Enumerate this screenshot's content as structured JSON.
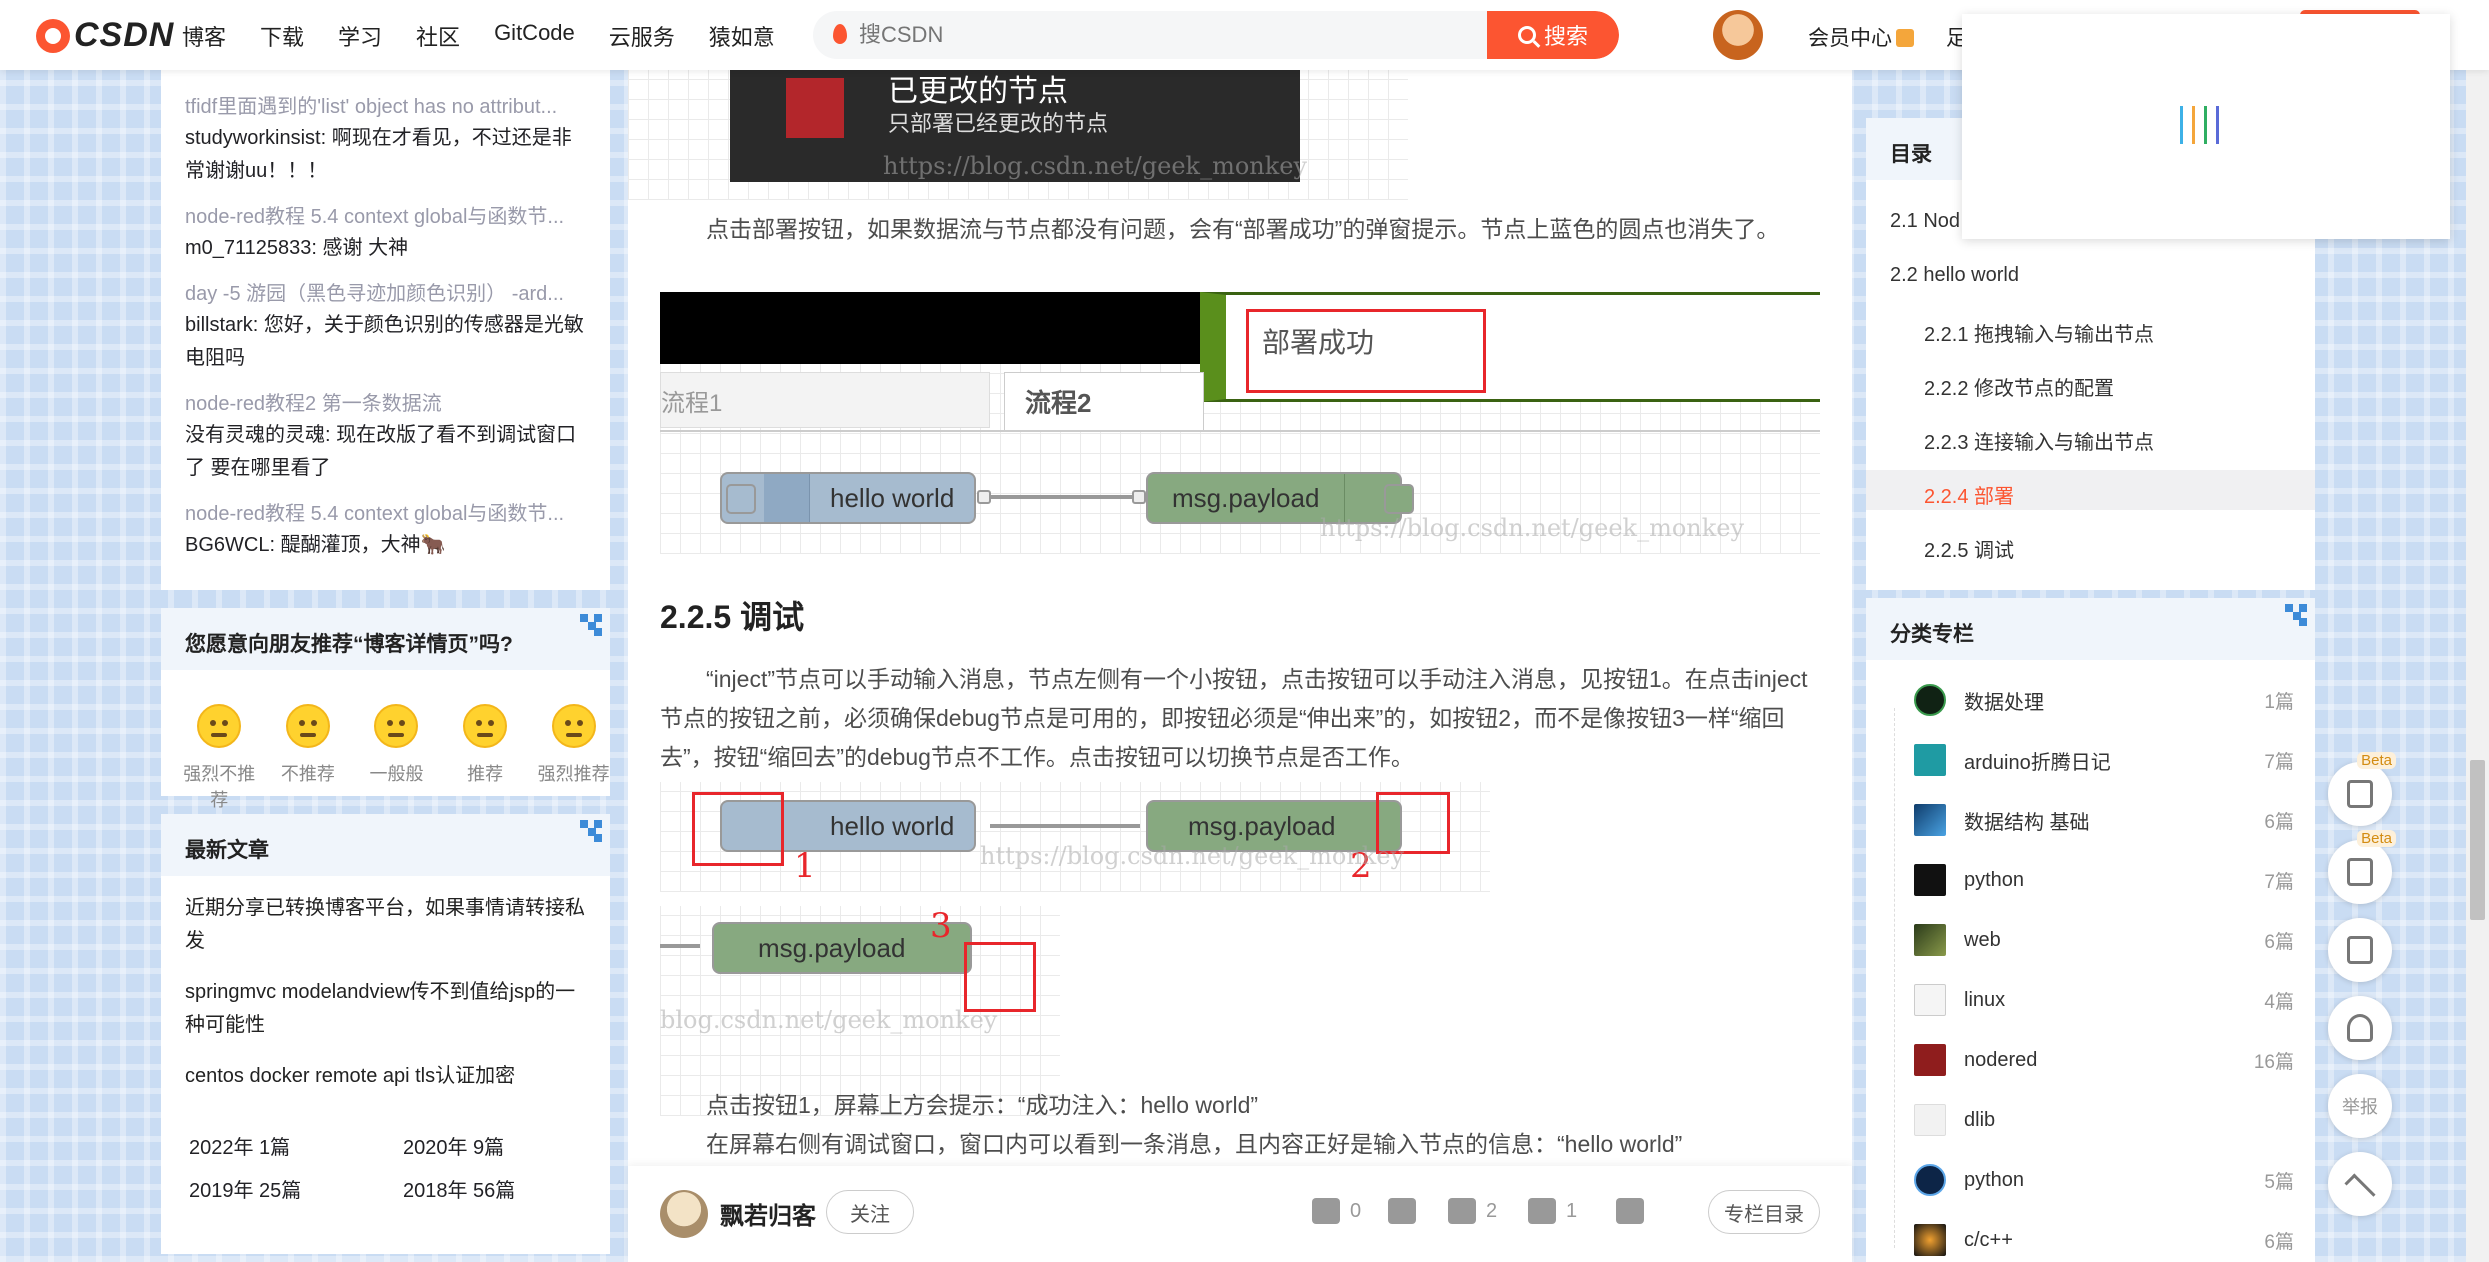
{
  "header": {
    "logo_text": "CSDN",
    "nav": [
      "博客",
      "下载",
      "学习",
      "社区",
      "GitCode",
      "云服务",
      "猿如意"
    ],
    "search_placeholder": "搜CSDN",
    "search_button": "搜索",
    "vip_label": "会员中心",
    "more_label": "足"
  },
  "loader_colors": [
    "#3db1e7",
    "#f4a63b",
    "#2fae62",
    "#5a6bd8"
  ],
  "left": {
    "comments": [
      {
        "title": "tfidf里面遇到的'list' object has no attribut...",
        "body": "studyworkinsist: 啊现在才看见，不过还是非常谢谢uu！！！"
      },
      {
        "title": "node-red教程 5.4 context global与函数节...",
        "body": "m0_71125833: 感谢 大神"
      },
      {
        "title": "day -5 游园（黑色寻迹加颜色识别） -ard...",
        "body": "billstark: 您好，关于颜色识别的传感器是光敏电阻吗"
      },
      {
        "title": "node-red教程2 第一条数据流",
        "body": "没有灵魂的灵魂: 现在改版了看不到调试窗口了 要在哪里看了"
      },
      {
        "title": "node-red教程 5.4 context global与函数节...",
        "body": "BG6WCL: 醍醐灌顶，大神🐂"
      }
    ],
    "recommend_title": "您愿意向朋友推荐“博客详情页”吗?",
    "faces": [
      "强烈不推荐",
      "不推荐",
      "一般般",
      "推荐",
      "强烈推荐"
    ],
    "latest_title": "最新文章",
    "latest": [
      "近期分享已转换博客平台，如果事情请转接私发",
      "springmvc modelandview传不到值给jsp的一种可能性",
      "centos docker remote api tls认证加密"
    ],
    "archive": [
      "2022年  1篇",
      "2020年  9篇",
      "2019年  25篇",
      "2018年  56篇"
    ]
  },
  "main": {
    "top_popup_title": "已更改的节点",
    "top_popup_sub": "只部署已经更改的节点",
    "watermark": "https://blog.csdn.net/geek_monkey",
    "watermark2": "blog.csdn.net/geek_monkey",
    "para1": "点击部署按钮，如果数据流与节点都没有问题，会有“部署成功”的弹窗提示。节点上蓝色的圆点也消失了。",
    "deploy_success": "部署成功",
    "tab1": "流程1",
    "tab2": "流程2",
    "node_inject": "hello world",
    "node_debug": "msg.payload",
    "heading": "2.2.5 调试",
    "para2": "“inject”节点可以手动输入消息，节点左侧有一个小按钮，点击按钮可以手动注入消息，见按钮1。在点击inject节点的按钮之前，必须确保debug节点是可用的，即按钮必须是“伸出来”的，如按钮2，而不是像按钮3一样“缩回去”，按钮“缩回去”的debug节点不工作。点击按钮可以切换节点是否工作。",
    "num1": "1",
    "num2": "2",
    "num3": "3",
    "para3": "点击按钮1，屏幕上方会提示：“成功注入：hello world”",
    "para4": "在屏幕右侧有调试窗口，窗口内可以看到一条消息，且内容正好是输入节点的信息：“hello world”"
  },
  "bottom": {
    "author": "飘若归客",
    "follow": "关注",
    "likes": "0",
    "stars": "2",
    "comments": "1",
    "column_toc": "专栏目录"
  },
  "right": {
    "toc_title": "目录",
    "toc": [
      "2.1 Nod",
      "2.2 hello world",
      "2.2.1 拖拽输入与输出节点",
      "2.2.2 修改节点的配置",
      "2.2.3 连接输入与输出节点",
      "2.2.4 部署",
      "2.2.5 调试"
    ],
    "cat_title": "分类专栏",
    "cats": [
      {
        "name": "数据处理",
        "count": "1篇"
      },
      {
        "name": "arduino折腾日记",
        "count": "7篇"
      },
      {
        "name": "数据结构 基础",
        "count": "6篇"
      },
      {
        "name": "python",
        "count": "7篇"
      },
      {
        "name": "web",
        "count": "6篇"
      },
      {
        "name": "linux",
        "count": "4篇"
      },
      {
        "name": "nodered",
        "count": "16篇"
      },
      {
        "name": "dlib",
        "count": ""
      },
      {
        "name": "python",
        "count": "5篇"
      },
      {
        "name": "c/c++",
        "count": "6篇"
      }
    ],
    "beta": "Beta",
    "report": "举报"
  }
}
